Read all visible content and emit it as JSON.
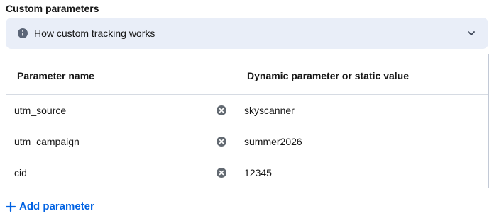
{
  "section": {
    "title": "Custom parameters"
  },
  "info": {
    "icon": "info-icon",
    "label": "How custom tracking works",
    "chevron_icon": "chevron-down-icon",
    "background": "#e9eef8"
  },
  "table": {
    "headers": {
      "name": "Parameter name",
      "value": "Dynamic parameter or static value"
    },
    "rows": [
      {
        "name": "utm_source",
        "value": "skyscanner"
      },
      {
        "name": "utm_campaign",
        "value": "summer2026"
      },
      {
        "name": "cid",
        "value": "12345"
      }
    ],
    "remove_icon": "remove-circle-icon"
  },
  "actions": {
    "add_label": "Add parameter",
    "add_icon": "plus-icon",
    "accent_color": "#0062e3"
  }
}
